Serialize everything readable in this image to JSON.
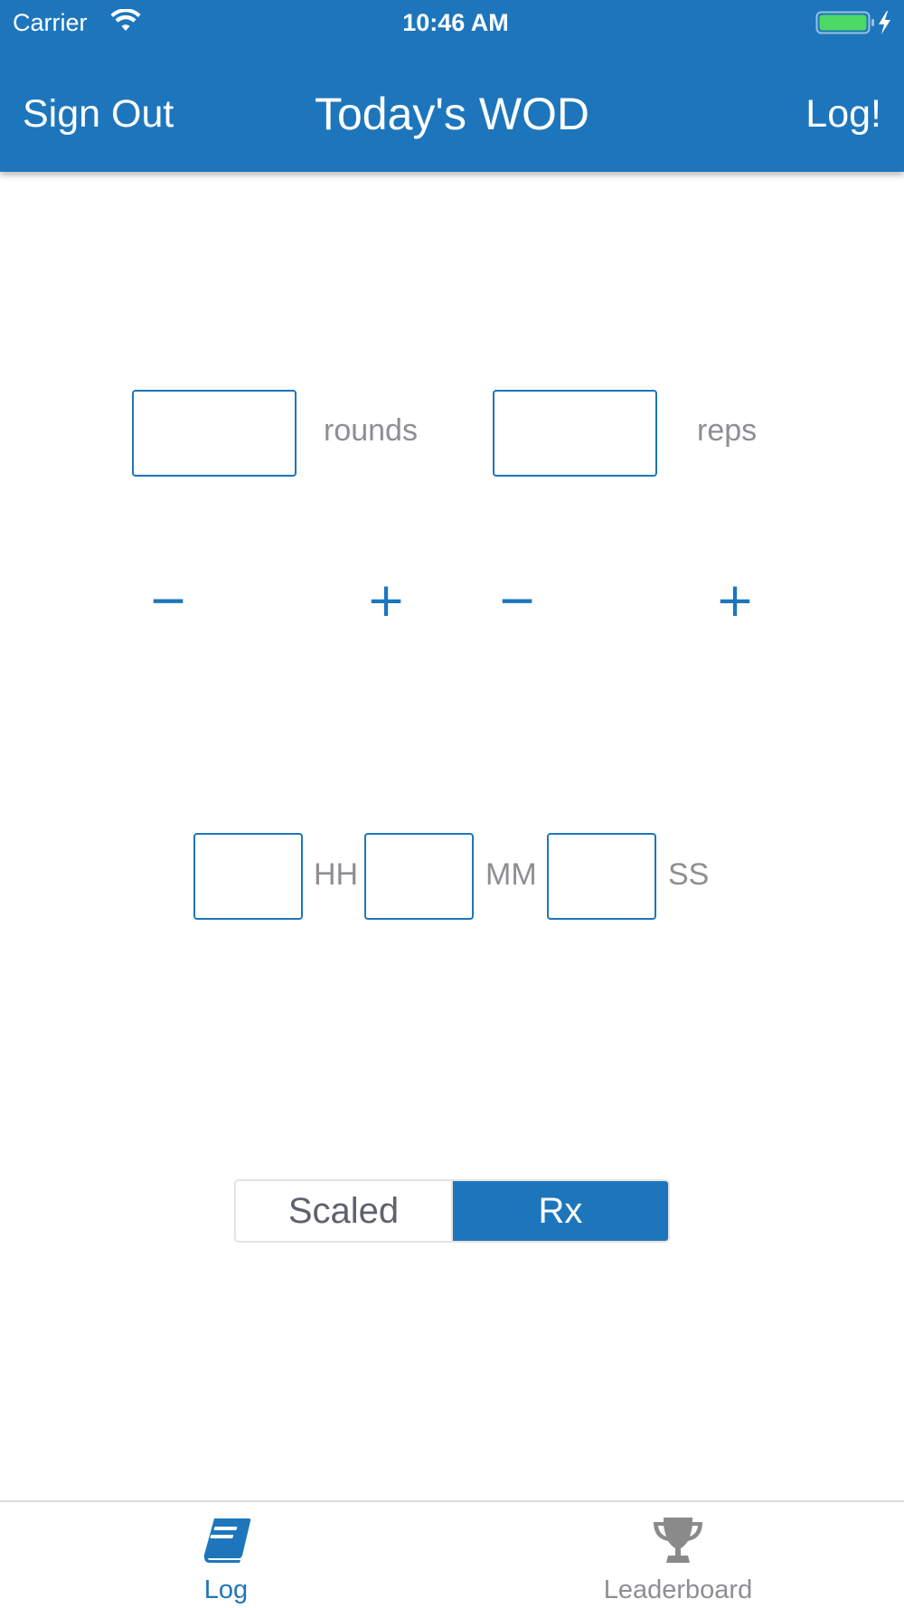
{
  "status_bar": {
    "carrier": "Carrier",
    "time": "10:46 AM"
  },
  "nav": {
    "left_label": "Sign Out",
    "title": "Today's WOD",
    "right_label": "Log!"
  },
  "score": {
    "rounds_value": "",
    "rounds_label": "rounds",
    "reps_value": "",
    "reps_label": "reps",
    "minus_symbol": "−",
    "plus_symbol": "+"
  },
  "time_input": {
    "hours_value": "",
    "hours_label": "HH",
    "minutes_value": "",
    "minutes_label": "MM",
    "seconds_value": "",
    "seconds_label": "SS"
  },
  "mode": {
    "options": [
      "Scaled",
      "Rx"
    ],
    "selected": "Rx"
  },
  "tabs": [
    {
      "label": "Log",
      "icon": "book-icon",
      "active": true
    },
    {
      "label": "Leaderboard",
      "icon": "trophy-icon",
      "active": false
    }
  ],
  "colors": {
    "accent": "#1d76bc",
    "muted_text": "#8e8e93",
    "battery_fill": "#4cd964"
  }
}
